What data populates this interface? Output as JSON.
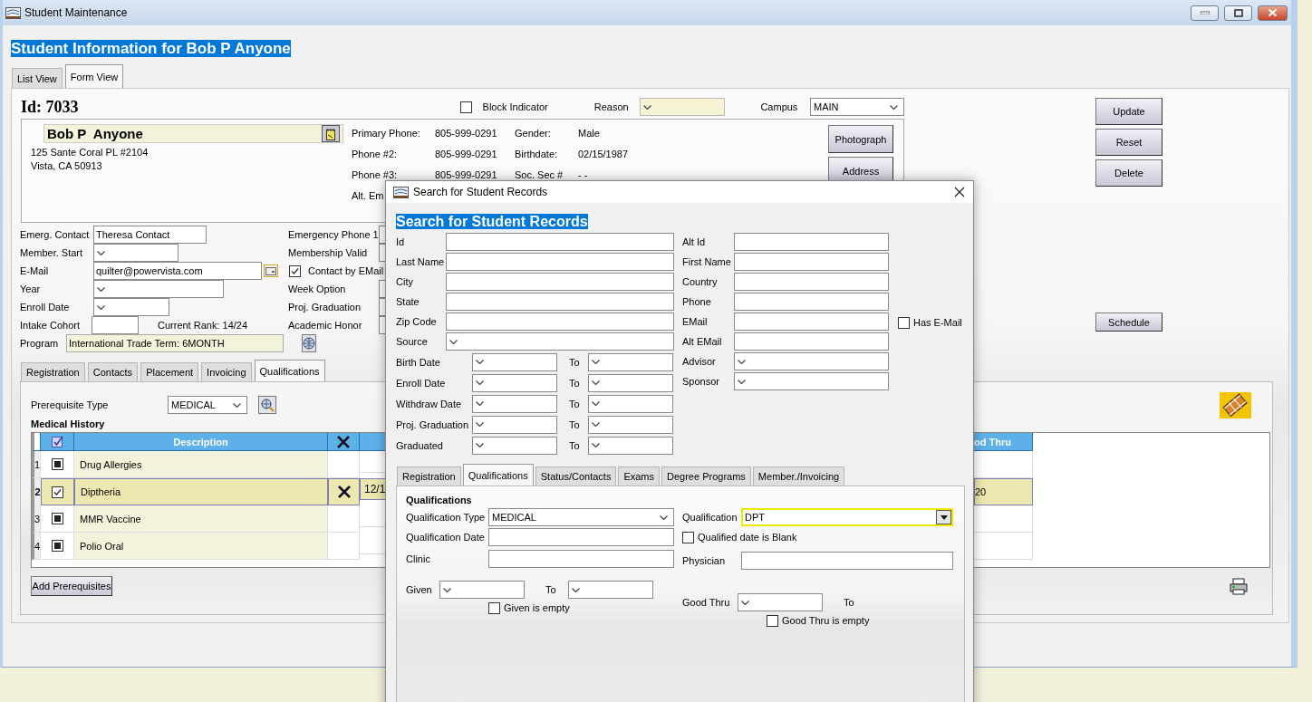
{
  "window": {
    "title": "Student Maintenance"
  },
  "heading": "Student Information for Bob P Anyone",
  "view_tabs": [
    {
      "label": "List View",
      "selected": false
    },
    {
      "label": "Form View",
      "selected": true
    }
  ],
  "record": {
    "id": "Id: 7033",
    "block_indicator": {
      "label": "Block Indicator",
      "checked": false
    },
    "reason": {
      "label": "Reason"
    },
    "campus": {
      "label": "Campus",
      "value": "MAIN"
    },
    "name": "Bob P  Anyone",
    "address": [
      "125 Sante Coral PL #2104",
      "Vista, CA 50913"
    ],
    "contact_info": [
      {
        "label": "Primary Phone:",
        "value": "805-999-0291"
      },
      {
        "label": "Phone #2:",
        "value": "805-999-0291"
      },
      {
        "label": "Phone #3:",
        "value": "805-999-0291"
      },
      {
        "label": "Alt. Em"
      }
    ],
    "personal": [
      {
        "label": "Gender:",
        "value": "Male"
      },
      {
        "label": "Birthdate:",
        "value": "02/15/1987"
      },
      {
        "label": "Soc. Sec #",
        "value": "-  -"
      }
    ],
    "side_buttons": [
      "Photograph",
      "Address"
    ]
  },
  "fields_left": [
    {
      "kind": "text",
      "label": "Emerg. Contact",
      "value": "Theresa Contact"
    },
    {
      "kind": "select",
      "label": "Member. Start"
    },
    {
      "kind": "email",
      "label": "E-Mail",
      "value": "quilter@powervista.com"
    },
    {
      "kind": "select",
      "label": "Year"
    },
    {
      "kind": "select",
      "label": "Enroll Date"
    },
    {
      "kind": "cohort",
      "label": "Intake Cohort",
      "note": "Current Rank: 14/24"
    },
    {
      "kind": "program",
      "label": "Program",
      "value": "International Trade Term: 6MONTH"
    }
  ],
  "fields_right": [
    {
      "kind": "field",
      "label": "Emergency Phone 1"
    },
    {
      "kind": "field",
      "label": "Membership Valid"
    },
    {
      "kind": "check",
      "label": "Contact by EMail",
      "checked": true
    },
    {
      "kind": "field",
      "label": "Week Option"
    },
    {
      "kind": "field",
      "label": "Proj. Graduation"
    },
    {
      "kind": "field",
      "label": "Academic Honor"
    }
  ],
  "action_buttons": [
    "Update",
    "Reset",
    "Delete"
  ],
  "schedule_button": "Schedule",
  "detail_tabs": [
    {
      "label": "Registration",
      "selected": false
    },
    {
      "label": "Contacts",
      "selected": false
    },
    {
      "label": "Placement",
      "selected": false
    },
    {
      "label": "Invoicing",
      "selected": false
    },
    {
      "label": "Qualifications",
      "selected": true
    }
  ],
  "prerequisite_type": {
    "label": "Prerequisite Type",
    "value": "MEDICAL"
  },
  "section_title": "Medical History",
  "table": {
    "columns": [
      {
        "kind": "number"
      },
      {
        "kind": "check"
      },
      {
        "kind": "text",
        "label": "Description"
      },
      {
        "kind": "remove"
      },
      {
        "kind": "date"
      },
      {
        "kind": "good_thru",
        "label": "od Thru"
      }
    ],
    "rows": [
      {
        "number": "1",
        "checked": false,
        "selected": false,
        "description": "Drug Allergies"
      },
      {
        "number": "2",
        "checked": true,
        "selected": true,
        "description": "Diptheria",
        "date": "12/1",
        "good_thru": "20"
      },
      {
        "number": "3",
        "checked": false,
        "selected": false,
        "description": "MMR Vaccine"
      },
      {
        "number": "4",
        "checked": false,
        "selected": false,
        "description": "Polio Oral"
      }
    ]
  },
  "add_button": "Add Prerequisites",
  "dialog": {
    "title": "Search for Student Records",
    "heading": "Search for Student Records",
    "fields_left": [
      {
        "kind": "text",
        "label": "Id"
      },
      {
        "kind": "text",
        "label": "Last Name"
      },
      {
        "kind": "text",
        "label": "City"
      },
      {
        "kind": "text",
        "label": "State"
      },
      {
        "kind": "text",
        "label": "Zip Code"
      },
      {
        "kind": "select",
        "label": "Source"
      }
    ],
    "date_ranges": [
      {
        "label": "Birth Date",
        "to": "To"
      },
      {
        "label": "Enroll Date",
        "to": "To"
      },
      {
        "label": "Withdraw Date",
        "to": "To"
      },
      {
        "label": "Proj. Graduation",
        "to": "To"
      },
      {
        "label": "Graduated",
        "to": "To"
      }
    ],
    "fields_right": [
      {
        "kind": "text",
        "label": "Alt Id"
      },
      {
        "kind": "text",
        "label": "First Name"
      },
      {
        "kind": "text",
        "label": "Country"
      },
      {
        "kind": "text",
        "label": "Phone"
      },
      {
        "kind": "text",
        "label": "EMail"
      },
      {
        "kind": "text",
        "label": "Alt EMail"
      },
      {
        "kind": "select",
        "label": "Advisor"
      },
      {
        "kind": "select",
        "label": "Sponsor"
      }
    ],
    "has_email": {
      "label": "Has E-Mail",
      "checked": false
    },
    "tabs": [
      {
        "label": "Registration",
        "selected": false
      },
      {
        "label": "Qualifications",
        "selected": true
      },
      {
        "label": "Status/Contacts",
        "selected": false
      },
      {
        "label": "Exams",
        "selected": false
      },
      {
        "label": "Degree Programs",
        "selected": false
      },
      {
        "label": "Member./Invoicing",
        "selected": false
      }
    ],
    "qualifications": {
      "title": "Qualifications",
      "type": {
        "label": "Qualification Type",
        "value": "MEDICAL"
      },
      "date": {
        "label": "Qualification Date"
      },
      "clinic": {
        "label": "Clinic"
      },
      "given": {
        "label": "Given",
        "to": "To"
      },
      "given_empty": {
        "label": "Given is empty",
        "checked": false
      },
      "qualification": {
        "label": "Qualification",
        "value": "DPT"
      },
      "blank": {
        "label": "Qualified date is Blank",
        "checked": false
      },
      "physician": {
        "label": "Physician"
      },
      "good_thru": {
        "label": "Good Thru",
        "to": "To"
      },
      "good_thru_empty": {
        "label": "Good Thru is empty",
        "checked": false
      }
    }
  }
}
